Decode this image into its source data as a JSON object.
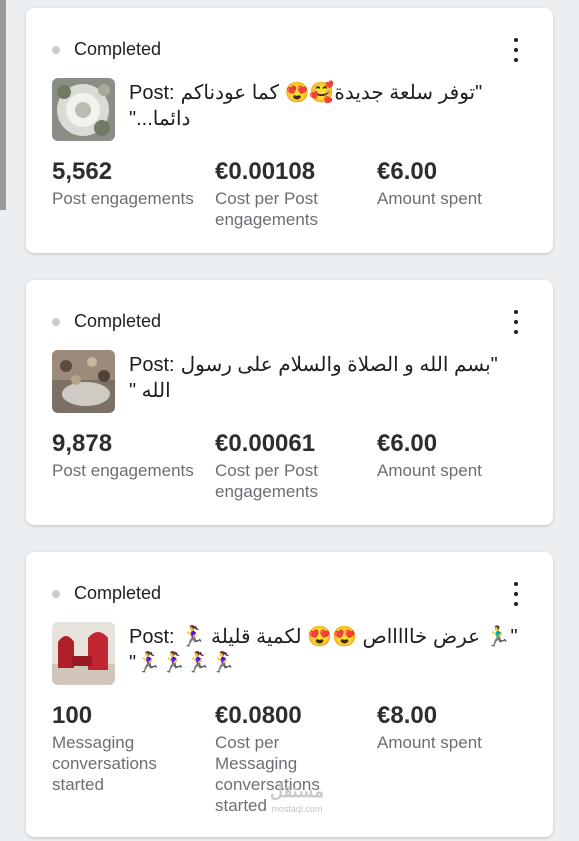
{
  "cards": [
    {
      "status": "Completed",
      "post_prefix": "Post:",
      "post_text": "\"توفر سلعة جديدة🥰😍 كما عودناكم دائما...\"",
      "metrics": [
        {
          "value": "5,562",
          "label": "Post engagements"
        },
        {
          "value": "€0.00108",
          "label": "Cost per Post engagements"
        },
        {
          "value": "€6.00",
          "label": "Amount spent"
        }
      ]
    },
    {
      "status": "Completed",
      "post_prefix": "Post:",
      "post_text": "\"بسم الله و الصلاة والسلام على رسول الله \"",
      "metrics": [
        {
          "value": "9,878",
          "label": "Post engagements"
        },
        {
          "value": "€0.00061",
          "label": "Cost per Post engagements"
        },
        {
          "value": "€6.00",
          "label": "Amount spent"
        }
      ]
    },
    {
      "status": "Completed",
      "post_prefix": "Post:",
      "post_text": "\"🏃‍♂️ عرض خاااااص 😍😍 لكمية قليلة 🏃‍♀️🏃‍♀️🏃‍♀️🏃‍♀️🏃‍♀️\"",
      "metrics": [
        {
          "value": "100",
          "label": "Messaging conversations started"
        },
        {
          "value": "€0.0800",
          "label": "Cost per Messaging conversations started"
        },
        {
          "value": "€8.00",
          "label": "Amount spent"
        }
      ]
    }
  ],
  "watermark": {
    "main": "مستقل",
    "sub": "mostaql.com"
  }
}
